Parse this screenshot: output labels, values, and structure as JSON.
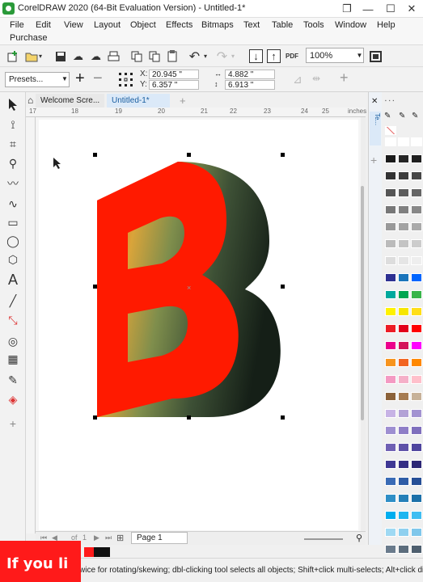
{
  "app": {
    "title": "CorelDRAW 2020 (64-Bit Evaluation Version) - Untitled-1*"
  },
  "window_controls": {
    "restore_glyph": "❐",
    "minimize_glyph": "—",
    "maximize_glyph": "☐",
    "close_glyph": "✕"
  },
  "menu": [
    {
      "label": "File"
    },
    {
      "label": "Edit"
    },
    {
      "label": "View"
    },
    {
      "label": "Layout"
    },
    {
      "label": "Object"
    },
    {
      "label": "Effects"
    },
    {
      "label": "Bitmaps"
    },
    {
      "label": "Text"
    },
    {
      "label": "Table"
    },
    {
      "label": "Tools"
    },
    {
      "label": "Window"
    },
    {
      "label": "Help"
    },
    {
      "label": "Purchase"
    }
  ],
  "toolbar": {
    "zoom": "100%",
    "pdf_label": "PDF"
  },
  "property_bar": {
    "presets": "Presets...",
    "x_label": "X:",
    "x_value": "20.945 \"",
    "y_label": "Y:",
    "y_value": "6.357 \"",
    "width_value": "4.882 \"",
    "height_value": "6.913 \""
  },
  "tabs": {
    "welcome": "Welcome Scre...",
    "document": "Untitled-1*",
    "add": "+"
  },
  "ruler": {
    "top_numbers": [
      "17",
      "18",
      "19",
      "20",
      "21",
      "22",
      "23",
      "24",
      "25"
    ],
    "units": "inches"
  },
  "docker": {
    "tab_label": "Te..."
  },
  "page_nav": {
    "page_of": "of",
    "page_number": "1",
    "page_label": "Page 1"
  },
  "status": {
    "text": "wice for rotating/skewing; dbl-clicking tool selects all objects; Shift+click multi-selects; Alt+click digs; Ctrl+"
  },
  "overlay": {
    "text": "If you li"
  },
  "colors": {
    "letter_face": "#ff1a00",
    "extrude_dark": "#1b2a1f",
    "accent_tab": "#dbe9f8",
    "overlay_red": "#ff1a1a"
  }
}
